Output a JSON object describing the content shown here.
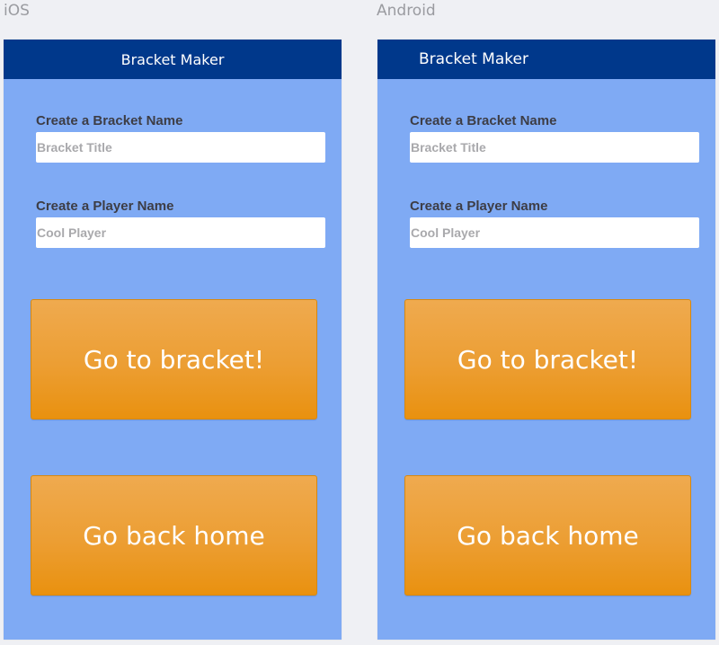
{
  "labels": {
    "ios": "iOS",
    "android": "Android"
  },
  "screen": {
    "title": "Bracket Maker",
    "bracket_name_label": "Create a Bracket Name",
    "bracket_name_placeholder": "Bracket Title",
    "player_name_label": "Create a Player Name",
    "player_name_placeholder": "Cool Player",
    "go_to_bracket_label": "Go to bracket!",
    "go_back_home_label": "Go back home"
  },
  "colors": {
    "background": "#eff0f4",
    "screen_background": "#7faaf4",
    "navbar": "#00388b",
    "button": "#ec9e33"
  }
}
